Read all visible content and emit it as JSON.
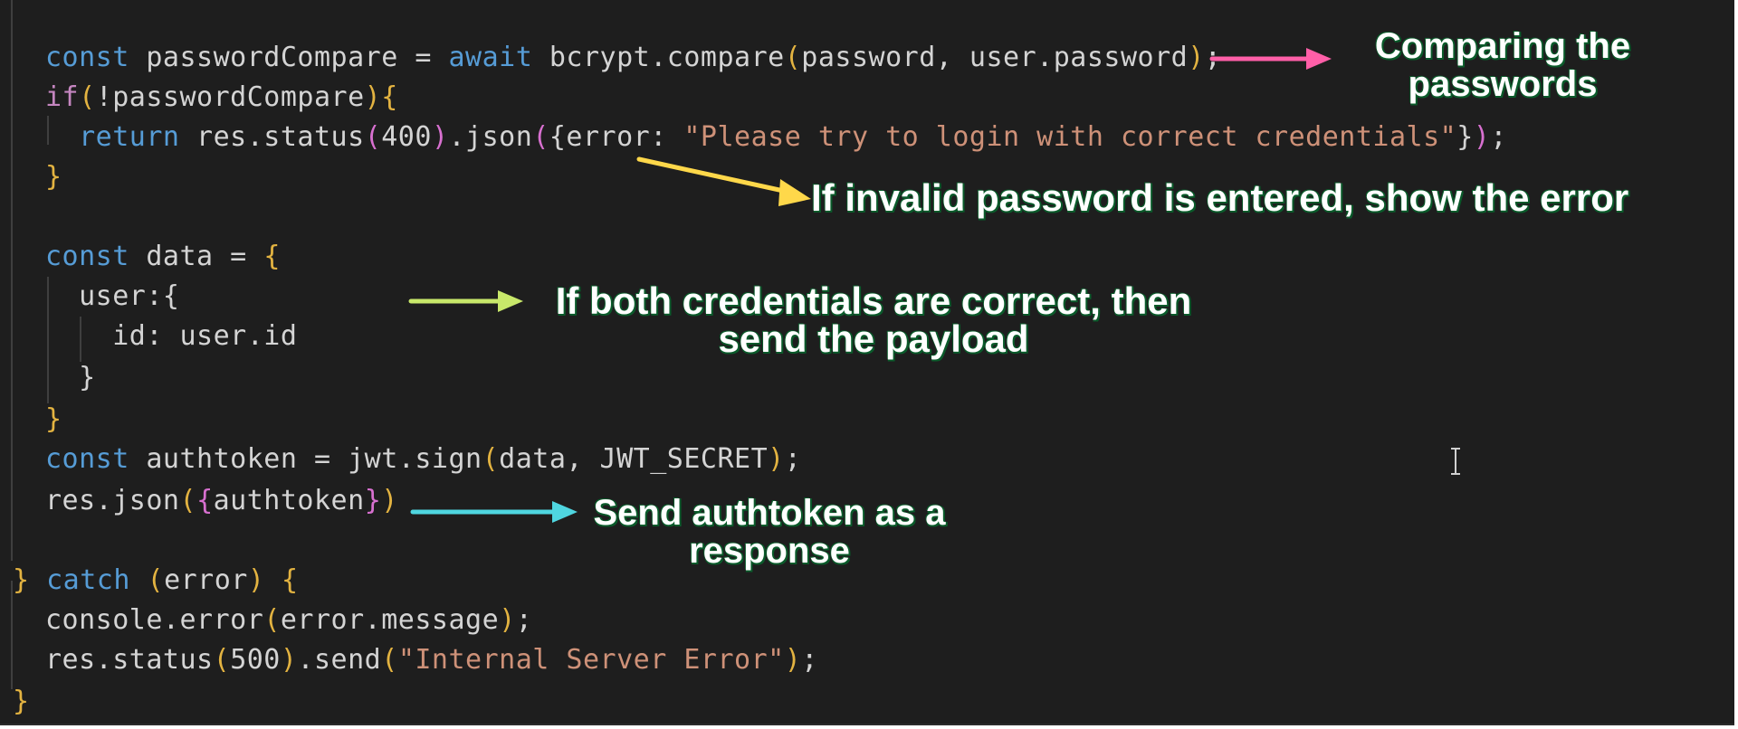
{
  "code": {
    "lines": [
      {
        "id": "l1",
        "tokens": [
          [
            "kw",
            "const"
          ],
          [
            "vr",
            " passwordCompare = "
          ],
          [
            "kw",
            "await"
          ],
          [
            "vr",
            " bcrypt.compare"
          ],
          [
            "br1",
            "("
          ],
          [
            "vr",
            "password, user.password"
          ],
          [
            "br1",
            ")"
          ],
          [
            "vr",
            ";"
          ]
        ]
      },
      {
        "id": "l2",
        "tokens": [
          [
            "pl",
            "if"
          ],
          [
            "br1",
            "("
          ],
          [
            "vr",
            "!passwordCompare"
          ],
          [
            "br1",
            ")"
          ],
          [
            "br1",
            "{"
          ]
        ]
      },
      {
        "id": "l3",
        "tokens": [
          [
            "vr",
            "  "
          ],
          [
            "kw",
            "return"
          ],
          [
            "vr",
            " res.status"
          ],
          [
            "br2",
            "("
          ],
          [
            "num",
            "400"
          ],
          [
            "br2",
            ")"
          ],
          [
            "vr",
            ".json"
          ],
          [
            "br2",
            "("
          ],
          [
            "vr",
            "{error: "
          ],
          [
            "str",
            "\"Please try to login with correct credentials\""
          ],
          [
            "vr",
            "}"
          ],
          [
            "br2",
            ")"
          ],
          [
            "vr",
            ";"
          ]
        ]
      },
      {
        "id": "l4",
        "tokens": [
          [
            "br1",
            "}"
          ]
        ]
      },
      {
        "id": "l5",
        "tokens": []
      },
      {
        "id": "l6",
        "tokens": [
          [
            "kw",
            "const"
          ],
          [
            "vr",
            " data = "
          ],
          [
            "br1",
            "{"
          ]
        ]
      },
      {
        "id": "l7",
        "tokens": [
          [
            "vr",
            "  user:{"
          ]
        ]
      },
      {
        "id": "l8",
        "tokens": [
          [
            "vr",
            "    id: user.id"
          ]
        ]
      },
      {
        "id": "l9",
        "tokens": [
          [
            "vr",
            "  }"
          ]
        ]
      },
      {
        "id": "l10",
        "tokens": [
          [
            "br1",
            "}"
          ]
        ]
      },
      {
        "id": "l11",
        "tokens": [
          [
            "kw",
            "const"
          ],
          [
            "vr",
            " authtoken = jwt.sign"
          ],
          [
            "br1",
            "("
          ],
          [
            "vr",
            "data, JWT_SECRET"
          ],
          [
            "br1",
            ")"
          ],
          [
            "vr",
            ";"
          ]
        ]
      },
      {
        "id": "l12",
        "tokens": [
          [
            "vr",
            "res.json"
          ],
          [
            "br1",
            "("
          ],
          [
            "br2",
            "{"
          ],
          [
            "vr",
            "authtoken"
          ],
          [
            "br2",
            "}"
          ],
          [
            "br1",
            ")"
          ]
        ]
      },
      {
        "id": "l13",
        "tokens": []
      },
      {
        "id": "l14",
        "tokens": [
          [
            "br1",
            "}"
          ],
          [
            "vr",
            " "
          ],
          [
            "kw",
            "catch"
          ],
          [
            "vr",
            " "
          ],
          [
            "br1",
            "("
          ],
          [
            "vr",
            "error"
          ],
          [
            "br1",
            ")"
          ],
          [
            "vr",
            " "
          ],
          [
            "br1",
            "{"
          ]
        ]
      },
      {
        "id": "l15",
        "tokens": [
          [
            "vr",
            "console.error"
          ],
          [
            "br1",
            "("
          ],
          [
            "vr",
            "error.message"
          ],
          [
            "br1",
            ")"
          ],
          [
            "vr",
            ";"
          ]
        ]
      },
      {
        "id": "l16",
        "tokens": [
          [
            "vr",
            "res.status"
          ],
          [
            "br1",
            "("
          ],
          [
            "num",
            "500"
          ],
          [
            "br1",
            ")"
          ],
          [
            "vr",
            ".send"
          ],
          [
            "br1",
            "("
          ],
          [
            "str",
            "\"Internal Server Error\""
          ],
          [
            "br1",
            ")"
          ],
          [
            "vr",
            ";"
          ]
        ]
      },
      {
        "id": "l17",
        "tokens": [
          [
            "br1",
            "}"
          ]
        ]
      }
    ]
  },
  "annotations": {
    "compare_line1": "Comparing the",
    "compare_line2": "passwords",
    "invalid": "If invalid password is entered, show the error",
    "payload_line1": "If both credentials are correct, then",
    "payload_line2": "send the payload",
    "authtoken_line1": "Send authtoken as a",
    "authtoken_line2": "response"
  },
  "colors": {
    "editor_bg": "#1e1e1e",
    "keyword": "#569cd6",
    "string": "#ce9178",
    "arrow_pink": "#ff5fa8",
    "arrow_yellow": "#ffd84a",
    "arrow_lime": "#c8e86a",
    "arrow_cyan": "#4fd6e0",
    "annotation_text": "#ffffff",
    "annotation_shadow": "#0a5a2a"
  }
}
